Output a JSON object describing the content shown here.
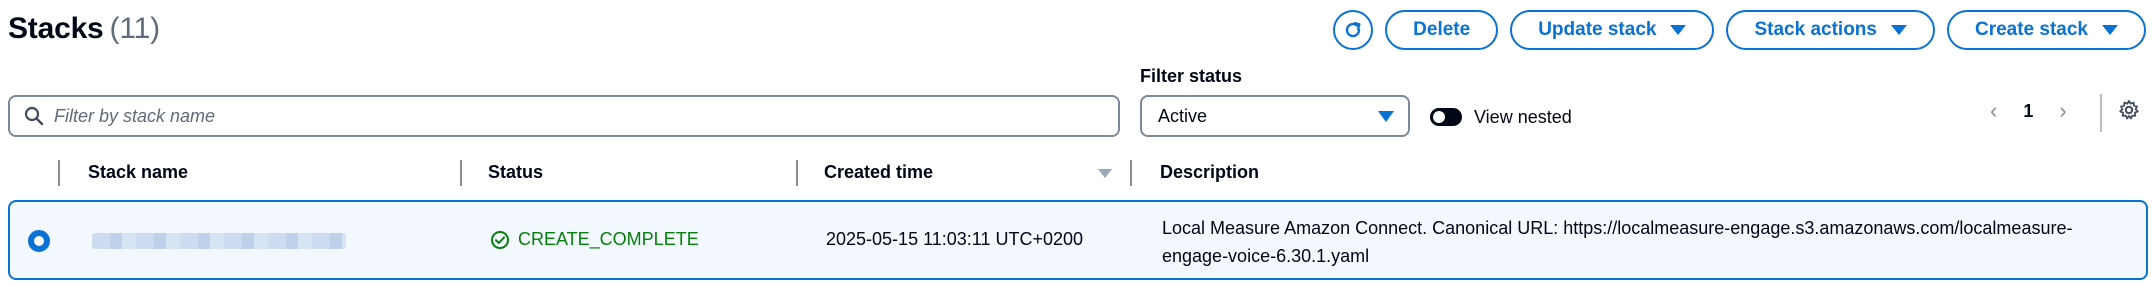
{
  "header": {
    "title": "Stacks",
    "count": "(11)"
  },
  "actions": {
    "refresh_icon": "refresh-icon",
    "delete": "Delete",
    "update_stack": "Update stack",
    "stack_actions": "Stack actions",
    "create_stack": "Create stack"
  },
  "search": {
    "placeholder": "Filter by stack name"
  },
  "filter_status": {
    "label": "Filter status",
    "value": "Active"
  },
  "view_nested": {
    "label": "View nested",
    "enabled": false
  },
  "pagination": {
    "current_page": "1"
  },
  "table": {
    "columns": [
      "Stack name",
      "Status",
      "Created time",
      "Description"
    ],
    "rows": [
      {
        "selected": true,
        "stack_name": "",
        "status": "CREATE_COMPLETE",
        "created_time": "2025-05-15 11:03:11 UTC+0200",
        "description": "Local Measure Amazon Connect. Canonical URL: https://localmeasure-engage.s3.amazonaws.com/localmeasure-engage-voice-6.30.1.yaml"
      }
    ]
  },
  "colors": {
    "accent": "#0972d3",
    "success": "#037f0c",
    "selected_row_bg": "#f2f8fd"
  }
}
